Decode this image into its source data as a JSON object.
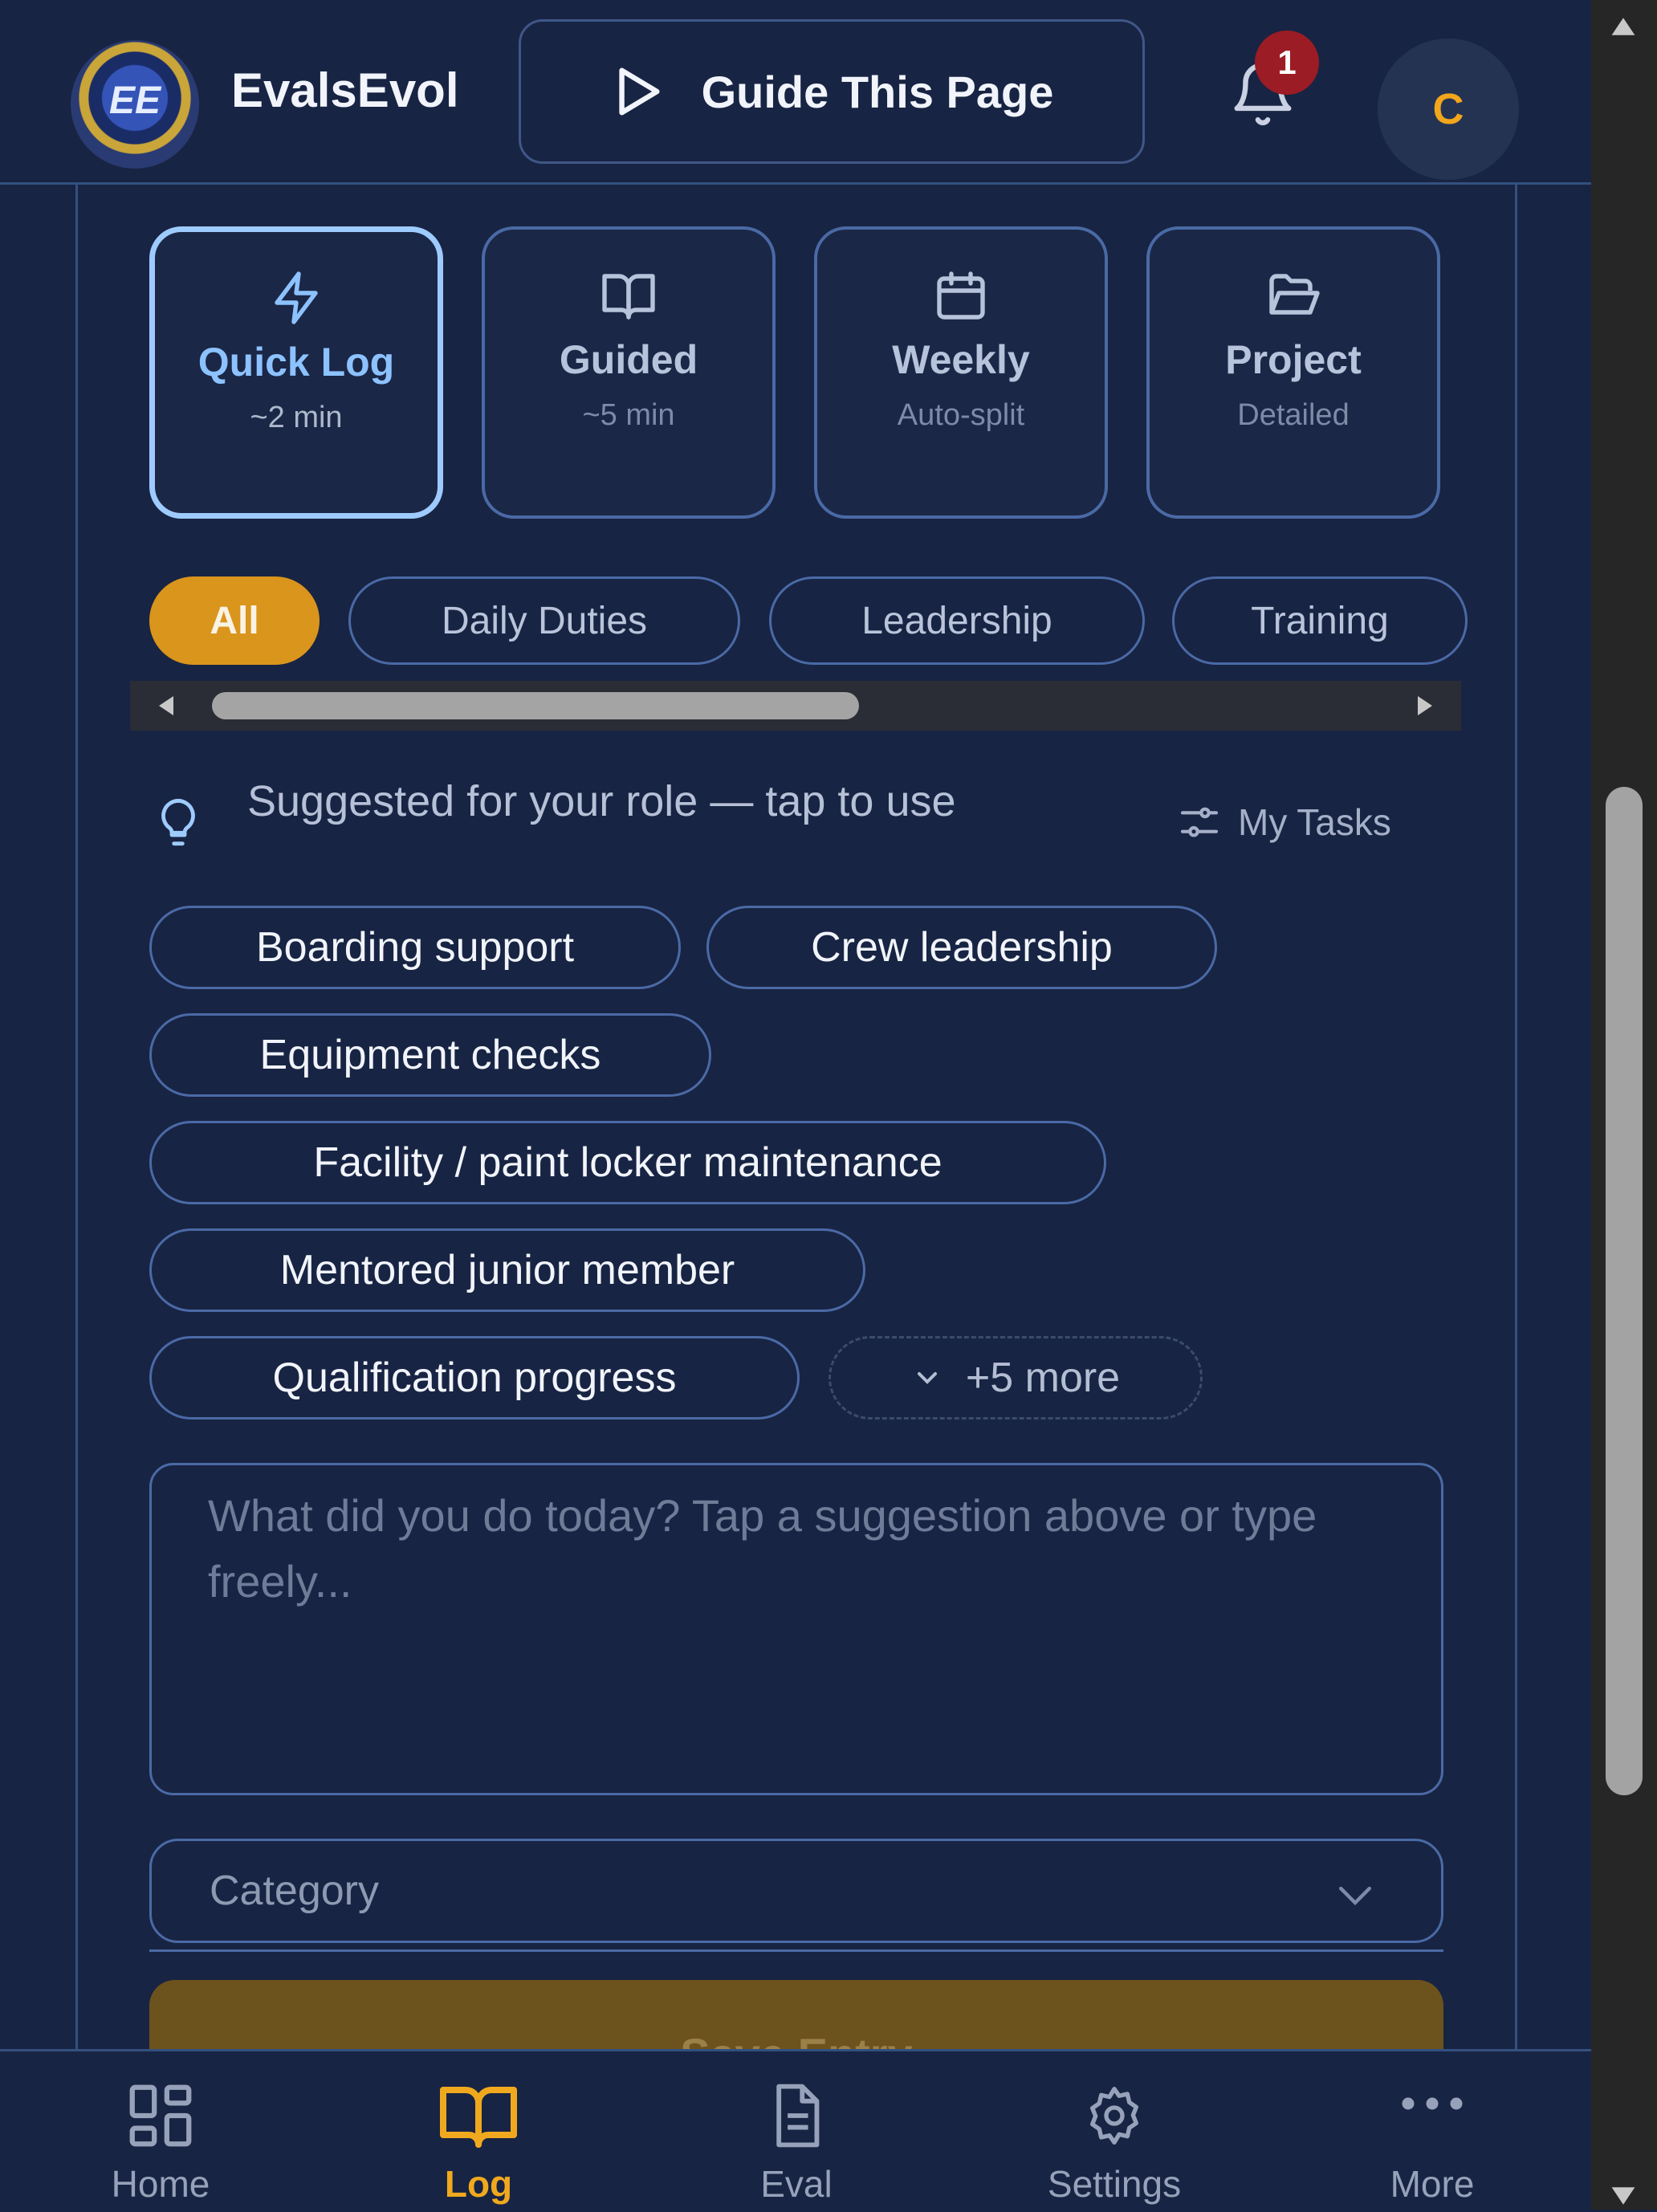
{
  "header": {
    "app_name": "EvalsEvol",
    "logo_letters": "EE",
    "guide_label": "Guide This Page",
    "notification_count": "1",
    "avatar_initial": "C"
  },
  "modes": [
    {
      "title": "Quick Log",
      "sub": "~2 min",
      "icon": "lightning-icon",
      "active": true
    },
    {
      "title": "Guided",
      "sub": "~5 min",
      "icon": "book-open-icon",
      "active": false
    },
    {
      "title": "Weekly",
      "sub": "Auto-split",
      "icon": "calendar-icon",
      "active": false
    },
    {
      "title": "Project",
      "sub": "Detailed",
      "icon": "folder-open-icon",
      "active": false
    }
  ],
  "filters": [
    "All",
    "Daily Duties",
    "Leadership",
    "Training"
  ],
  "suggestions": {
    "heading": "Suggested for your role — tap to use",
    "my_tasks": "My Tasks",
    "items": [
      "Boarding support",
      "Crew leadership",
      "Equipment checks",
      "Facility / paint locker maintenance",
      "Mentored junior member",
      "Qualification progress"
    ],
    "more": "+5 more"
  },
  "entry": {
    "placeholder": "What did you do today? Tap a suggestion above or type freely..."
  },
  "category": {
    "placeholder": "Category"
  },
  "save_label": "Save Entry",
  "nav": [
    {
      "label": "Home",
      "icon": "grid-icon",
      "active": false
    },
    {
      "label": "Log",
      "icon": "book-icon",
      "active": true
    },
    {
      "label": "Eval",
      "icon": "document-icon",
      "active": false
    },
    {
      "label": "Settings",
      "icon": "gear-icon",
      "active": false
    },
    {
      "label": "More",
      "icon": "ellipsis-icon",
      "active": false
    }
  ],
  "colors": {
    "background": "#182443",
    "accent": "#d9951c",
    "active_border": "#9ecbff",
    "badge": "#9b1c24"
  }
}
